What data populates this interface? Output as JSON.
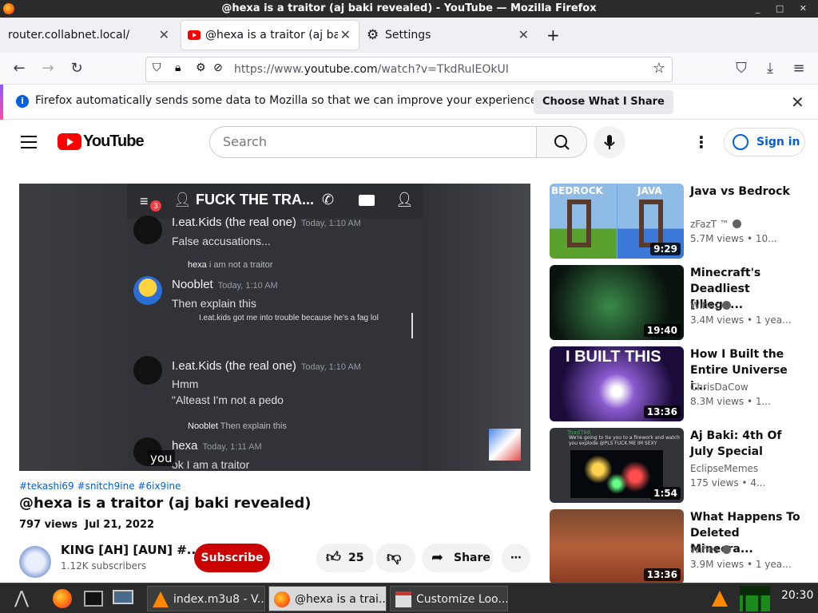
{
  "window": {
    "title": "@hexa is a traitor (aj baki revealed) - YouTube — Mozilla Firefox"
  },
  "tabs": [
    {
      "label": "router.collabnet.local/"
    },
    {
      "label": "@hexa is a traitor (aj baki revealed) - YouTube"
    },
    {
      "label": "Settings"
    }
  ],
  "url": {
    "prefix": "https://www.",
    "domain": "youtube.com",
    "path": "/watch?v=TkdRuIEOkUI"
  },
  "notification": {
    "message": "Firefox automatically sends some data to Mozilla so that we can improve your experience.",
    "action_label": "Choose What I Share"
  },
  "youtube": {
    "logo_text": "YouTube",
    "search_placeholder": "Search",
    "signin_label": "Sign in"
  },
  "player": {
    "caption": "you",
    "discord": {
      "channel": "FUCK THE TRA...",
      "badge": "3",
      "messages": [
        {
          "author": "I.eat.Kids (the real one)",
          "time": "Today, 1:10 AM",
          "text": "False accusations..."
        },
        {
          "reply_to": "hexa",
          "reply_text": "i am not a traitor",
          "author": "Nooblet",
          "time": "Today, 1:10 AM",
          "text": "Then explain this",
          "sub": "I.eat.kids got me into trouble because he's a fag lol"
        },
        {
          "author": "I.eat.Kids (the real one)",
          "time": "Today, 1:10 AM",
          "text": "Hmm",
          "text2": "\"Alteast I'm not a pedo"
        },
        {
          "reply_to": "Nooblet",
          "reply_text": "Then explain this",
          "author": "hexa",
          "time": "Today, 1:11 AM",
          "text": "ok I am a traitor"
        }
      ]
    }
  },
  "video": {
    "hashtags": "#tekashi69 #snitch9ine #6ix9ine",
    "title": "@hexa is a traitor (aj baki revealed)",
    "views": "797 views",
    "date": "Jul 21, 2022",
    "channel": "KING [AH] [AUN] #...",
    "subscribers": "1.12K subscribers",
    "subscribe_label": "Subscribe",
    "likes": "25",
    "share_label": "Share"
  },
  "recommendations": [
    {
      "title": "Java vs Bedrock",
      "channel": "zFazT ™",
      "verified": true,
      "views": "5.7M views",
      "age": "10...",
      "duration": "9:29",
      "thumb_left": "BEDROCK",
      "thumb_right": "JAVA"
    },
    {
      "title": "Minecraft's Deadliest [Illega...",
      "channel": "Wifies",
      "verified": true,
      "views": "3.4M views",
      "age": "1 yea...",
      "duration": "19:40"
    },
    {
      "title": "How I Built the Entire Universe i...",
      "channel": "ChrisDaCow",
      "verified": false,
      "views": "8.3M views",
      "age": "1...",
      "duration": "13:36",
      "thumb_text": "I BUILT THIS"
    },
    {
      "title": "Aj Baki: 4th Of July Special",
      "channel": "EclipseMemes",
      "verified": false,
      "views": "175 views",
      "age": "4...",
      "duration": "1:54",
      "thumb_text": "Toad786",
      "thumb_sub": "We're going to tie you to a firework and watch you explode @PLS FUCK ME IM SEXY"
    },
    {
      "title": "What Happens To Deleted Minecra...",
      "channel": "Wifies",
      "verified": true,
      "views": "3.9M views",
      "age": "1 yea...",
      "duration": "13:36"
    }
  ],
  "taskbar": {
    "windows": [
      {
        "label": "index.m3u8 - V..."
      },
      {
        "label": "@hexa is a trai..."
      },
      {
        "label": "Customize Loo..."
      }
    ],
    "clock": "20:30"
  },
  "colors": {
    "yt_red": "#ff0000",
    "subscribe_red": "#cc0000",
    "link_blue": "#065fd4",
    "firefox_blue": "#0060df"
  }
}
